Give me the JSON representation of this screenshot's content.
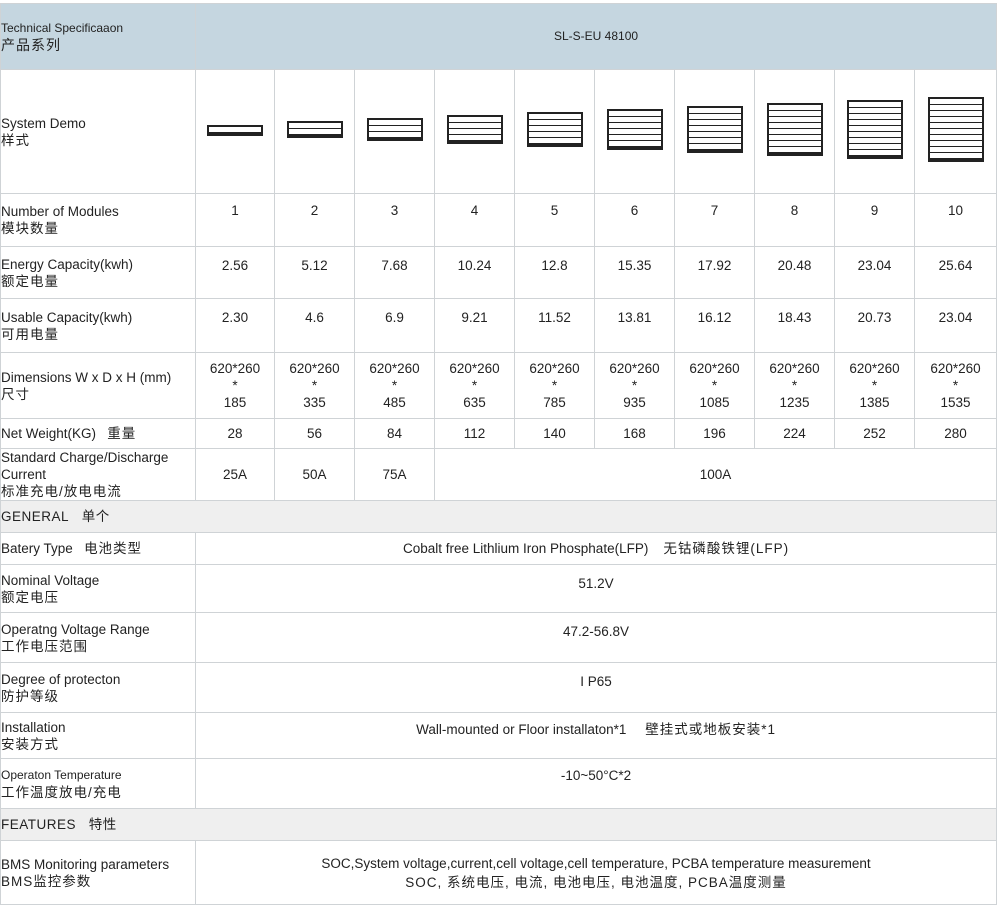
{
  "header": {
    "label_en": "Technical Specificaaon",
    "label_cn": "产品系列",
    "model": "SL-S-EU 48100"
  },
  "system_demo": {
    "label_en": "System Demo",
    "label_cn": "样式"
  },
  "modules": {
    "label_en": "Number of Modules",
    "label_cn": "模块数量",
    "values": [
      "1",
      "2",
      "3",
      "4",
      "5",
      "6",
      "7",
      "8",
      "9",
      "10"
    ]
  },
  "energy": {
    "label_en": "Energy Capacity(kwh)",
    "label_cn": "额定电量",
    "values": [
      "2.56",
      "5.12",
      "7.68",
      "10.24",
      "12.8",
      "15.35",
      "17.92",
      "20.48",
      "23.04",
      "25.64"
    ]
  },
  "usable": {
    "label_en": "Usable Capacity(kwh)",
    "label_cn": "可用电量",
    "values": [
      "2.30",
      "4.6",
      "6.9",
      "9.21",
      "11.52",
      "13.81",
      "16.12",
      "18.43",
      "20.73",
      "23.04"
    ]
  },
  "dimensions": {
    "label_en": "Dimensions W x D x H (mm)",
    "label_cn": "尺寸",
    "wd": "620*260",
    "sep": "*",
    "heights": [
      "185",
      "335",
      "485",
      "635",
      "785",
      "935",
      "1085",
      "1235",
      "1385",
      "1535"
    ]
  },
  "weight": {
    "label_en": "Net Weight(KG)",
    "label_cn": "重量",
    "values": [
      "28",
      "56",
      "84",
      "112",
      "140",
      "168",
      "196",
      "224",
      "252",
      "280"
    ]
  },
  "charge": {
    "label_en_1": "Standard Charge/Discharge",
    "label_en_2": "Current",
    "label_cn": "标准充电/放电电流",
    "v1": "25A",
    "v2": "50A",
    "v3": "75A",
    "v_rest": "100A"
  },
  "general": {
    "en": "GENERAL",
    "cn": "单个"
  },
  "battery_type": {
    "label_en": "Batery Type",
    "label_cn": "电池类型",
    "value_en": "Cobalt free Lithlium Iron Phosphate(LFP)",
    "value_cn": "无钴磷酸铁锂(LFP)"
  },
  "nominal_voltage": {
    "label_en": "Nominal Voltage",
    "label_cn": "额定电压",
    "value": "51.2V"
  },
  "voltage_range": {
    "label_en": "Operatng Voltage Range",
    "label_cn": "工作电压范围",
    "value": "47.2-56.8V"
  },
  "protection": {
    "label_en": "Degree of protecton",
    "label_cn": "防护等级",
    "value": "I P65"
  },
  "installation": {
    "label_en": "Installation",
    "label_cn": "安装方式",
    "value_en": "Wall-mounted or Floor installaton*1",
    "value_cn": "壁挂式或地板安装*1"
  },
  "temperature": {
    "label_en": "Operaton Temperature",
    "label_cn": "工作温度放电/充电",
    "value": "-10~50°C*2"
  },
  "features": {
    "en": "FEATURES",
    "cn": "特性"
  },
  "bms": {
    "label_en": "BMS Monitoring parameters",
    "label_cn": "BMS监控参数",
    "value_en": "SOC,System voltage,current,cell voltage,cell temperature,  PCBA temperature measurement",
    "value_cn": "SOC, 系统电压, 电流, 电池电压, 电池温度, PCBA温度测量"
  }
}
